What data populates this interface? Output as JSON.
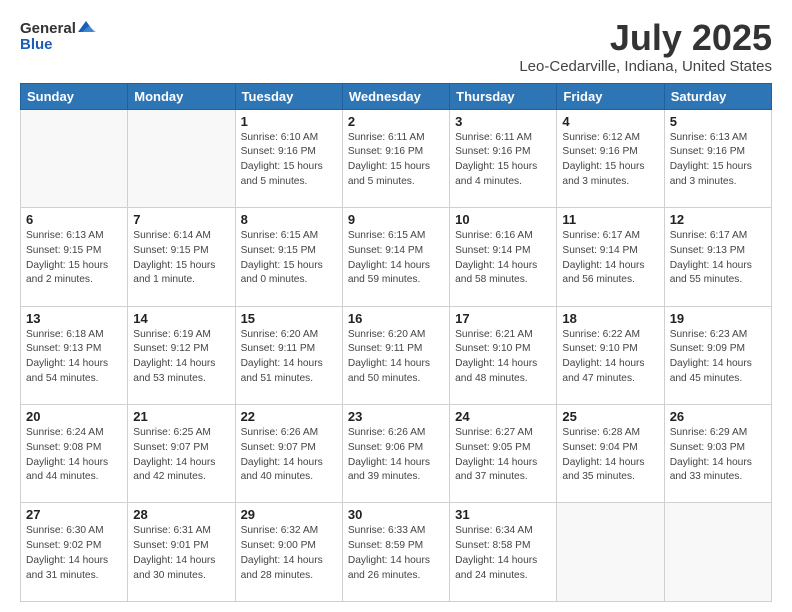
{
  "header": {
    "logo_general": "General",
    "logo_blue": "Blue",
    "title": "July 2025",
    "subtitle": "Leo-Cedarville, Indiana, United States"
  },
  "days_of_week": [
    "Sunday",
    "Monday",
    "Tuesday",
    "Wednesday",
    "Thursday",
    "Friday",
    "Saturday"
  ],
  "weeks": [
    [
      {
        "day": "",
        "info": ""
      },
      {
        "day": "",
        "info": ""
      },
      {
        "day": "1",
        "info": "Sunrise: 6:10 AM\nSunset: 9:16 PM\nDaylight: 15 hours and 5 minutes."
      },
      {
        "day": "2",
        "info": "Sunrise: 6:11 AM\nSunset: 9:16 PM\nDaylight: 15 hours and 5 minutes."
      },
      {
        "day": "3",
        "info": "Sunrise: 6:11 AM\nSunset: 9:16 PM\nDaylight: 15 hours and 4 minutes."
      },
      {
        "day": "4",
        "info": "Sunrise: 6:12 AM\nSunset: 9:16 PM\nDaylight: 15 hours and 3 minutes."
      },
      {
        "day": "5",
        "info": "Sunrise: 6:13 AM\nSunset: 9:16 PM\nDaylight: 15 hours and 3 minutes."
      }
    ],
    [
      {
        "day": "6",
        "info": "Sunrise: 6:13 AM\nSunset: 9:15 PM\nDaylight: 15 hours and 2 minutes."
      },
      {
        "day": "7",
        "info": "Sunrise: 6:14 AM\nSunset: 9:15 PM\nDaylight: 15 hours and 1 minute."
      },
      {
        "day": "8",
        "info": "Sunrise: 6:15 AM\nSunset: 9:15 PM\nDaylight: 15 hours and 0 minutes."
      },
      {
        "day": "9",
        "info": "Sunrise: 6:15 AM\nSunset: 9:14 PM\nDaylight: 14 hours and 59 minutes."
      },
      {
        "day": "10",
        "info": "Sunrise: 6:16 AM\nSunset: 9:14 PM\nDaylight: 14 hours and 58 minutes."
      },
      {
        "day": "11",
        "info": "Sunrise: 6:17 AM\nSunset: 9:14 PM\nDaylight: 14 hours and 56 minutes."
      },
      {
        "day": "12",
        "info": "Sunrise: 6:17 AM\nSunset: 9:13 PM\nDaylight: 14 hours and 55 minutes."
      }
    ],
    [
      {
        "day": "13",
        "info": "Sunrise: 6:18 AM\nSunset: 9:13 PM\nDaylight: 14 hours and 54 minutes."
      },
      {
        "day": "14",
        "info": "Sunrise: 6:19 AM\nSunset: 9:12 PM\nDaylight: 14 hours and 53 minutes."
      },
      {
        "day": "15",
        "info": "Sunrise: 6:20 AM\nSunset: 9:11 PM\nDaylight: 14 hours and 51 minutes."
      },
      {
        "day": "16",
        "info": "Sunrise: 6:20 AM\nSunset: 9:11 PM\nDaylight: 14 hours and 50 minutes."
      },
      {
        "day": "17",
        "info": "Sunrise: 6:21 AM\nSunset: 9:10 PM\nDaylight: 14 hours and 48 minutes."
      },
      {
        "day": "18",
        "info": "Sunrise: 6:22 AM\nSunset: 9:10 PM\nDaylight: 14 hours and 47 minutes."
      },
      {
        "day": "19",
        "info": "Sunrise: 6:23 AM\nSunset: 9:09 PM\nDaylight: 14 hours and 45 minutes."
      }
    ],
    [
      {
        "day": "20",
        "info": "Sunrise: 6:24 AM\nSunset: 9:08 PM\nDaylight: 14 hours and 44 minutes."
      },
      {
        "day": "21",
        "info": "Sunrise: 6:25 AM\nSunset: 9:07 PM\nDaylight: 14 hours and 42 minutes."
      },
      {
        "day": "22",
        "info": "Sunrise: 6:26 AM\nSunset: 9:07 PM\nDaylight: 14 hours and 40 minutes."
      },
      {
        "day": "23",
        "info": "Sunrise: 6:26 AM\nSunset: 9:06 PM\nDaylight: 14 hours and 39 minutes."
      },
      {
        "day": "24",
        "info": "Sunrise: 6:27 AM\nSunset: 9:05 PM\nDaylight: 14 hours and 37 minutes."
      },
      {
        "day": "25",
        "info": "Sunrise: 6:28 AM\nSunset: 9:04 PM\nDaylight: 14 hours and 35 minutes."
      },
      {
        "day": "26",
        "info": "Sunrise: 6:29 AM\nSunset: 9:03 PM\nDaylight: 14 hours and 33 minutes."
      }
    ],
    [
      {
        "day": "27",
        "info": "Sunrise: 6:30 AM\nSunset: 9:02 PM\nDaylight: 14 hours and 31 minutes."
      },
      {
        "day": "28",
        "info": "Sunrise: 6:31 AM\nSunset: 9:01 PM\nDaylight: 14 hours and 30 minutes."
      },
      {
        "day": "29",
        "info": "Sunrise: 6:32 AM\nSunset: 9:00 PM\nDaylight: 14 hours and 28 minutes."
      },
      {
        "day": "30",
        "info": "Sunrise: 6:33 AM\nSunset: 8:59 PM\nDaylight: 14 hours and 26 minutes."
      },
      {
        "day": "31",
        "info": "Sunrise: 6:34 AM\nSunset: 8:58 PM\nDaylight: 14 hours and 24 minutes."
      },
      {
        "day": "",
        "info": ""
      },
      {
        "day": "",
        "info": ""
      }
    ]
  ]
}
